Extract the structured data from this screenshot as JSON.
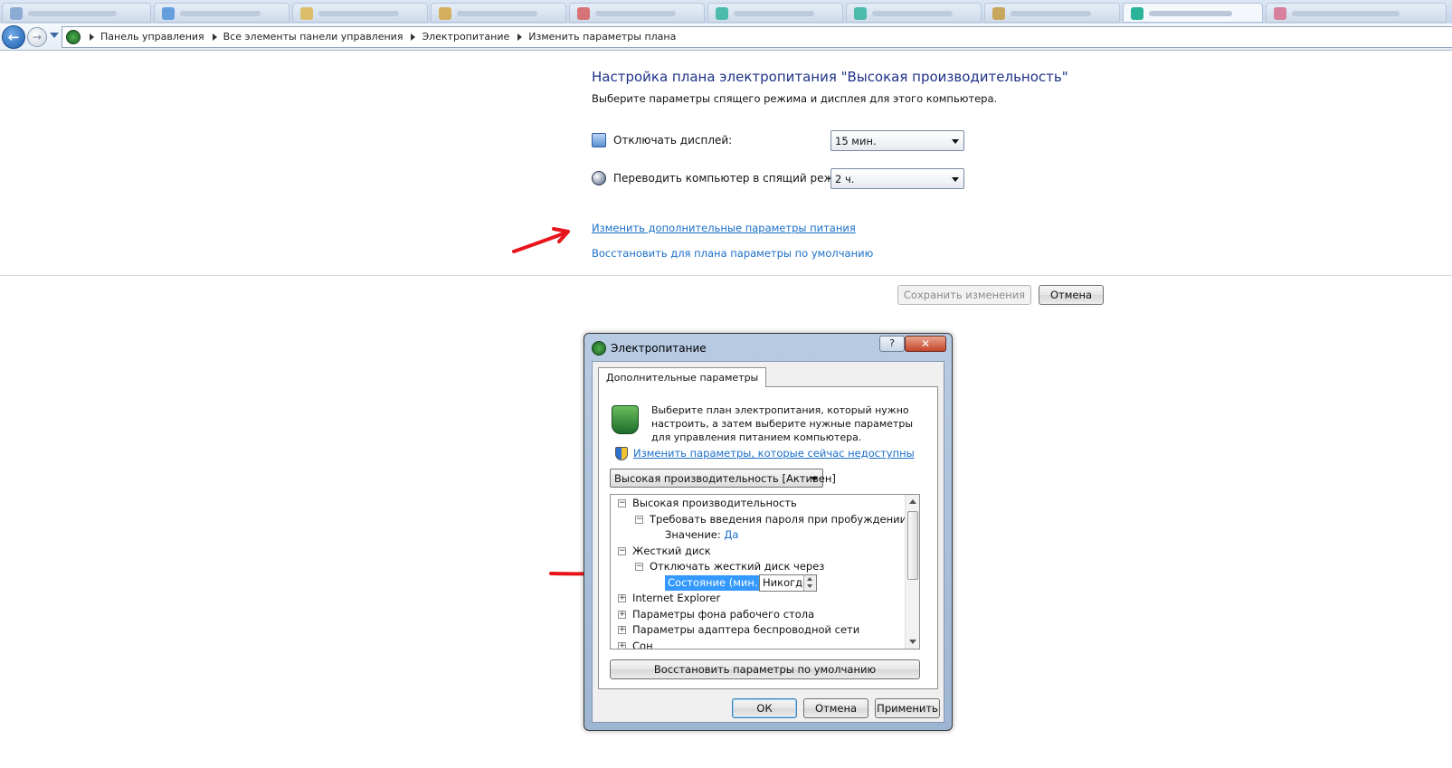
{
  "breadcrumb": [
    "Панель управления",
    "Все элементы панели управления",
    "Электропитание",
    "Изменить параметры плана"
  ],
  "page": {
    "title": "Настройка плана электропитания \"Высокая производительность\"",
    "subtitle": "Выберите параметры спящего режима и дисплея для этого компьютера.",
    "display_label": "Отключать дисплей:",
    "display_value": "15 мин.",
    "sleep_label": "Переводить компьютер в спящий режим:",
    "sleep_value": "2 ч.",
    "advanced_link": "Изменить дополнительные параметры питания",
    "restore_link": "Восстановить для плана параметры по умолчанию",
    "save_button": "Сохранить изменения",
    "cancel_button": "Отмена"
  },
  "dialog": {
    "title": "Электропитание",
    "help": "?",
    "close": "✕",
    "tab": "Дополнительные параметры",
    "description": "Выберите план электропитания, который нужно настроить, а затем выберите нужные параметры для управления питанием компьютера.",
    "unavailable_link": "Изменить параметры, которые сейчас недоступны",
    "plan": "Высокая производительность [Активен]",
    "tree": {
      "high_perf": "Высокая производительность",
      "require_password": "Требовать введения пароля при пробуждении",
      "value_label": "Значение:",
      "value": "Да",
      "hard_disk": "Жесткий диск",
      "turn_off_disk": "Отключать жесткий диск через",
      "state_label": "Состояние (мин.):",
      "state_value": "Никогда",
      "internet_explorer": "Internet Explorer",
      "desktop_background": "Параметры фона рабочего стола",
      "wireless_adapter": "Параметры адаптера беспроводной сети",
      "sleep": "Сон"
    },
    "restore_button": "Восстановить параметры по умолчанию",
    "ok_button": "ОК",
    "cancel_button": "Отмена",
    "apply_button": "Применить"
  },
  "colors": {
    "title_blue": "#1e3287",
    "link_blue": "#1a6fc7",
    "selection_blue": "#3399ff",
    "annotation_red": "#e8141c"
  },
  "icons": [
    "back-arrow-icon",
    "forward-arrow-icon",
    "control-panel-icon",
    "display-icon",
    "sleep-moon-icon",
    "power-plan-icon",
    "uac-shield-icon"
  ]
}
